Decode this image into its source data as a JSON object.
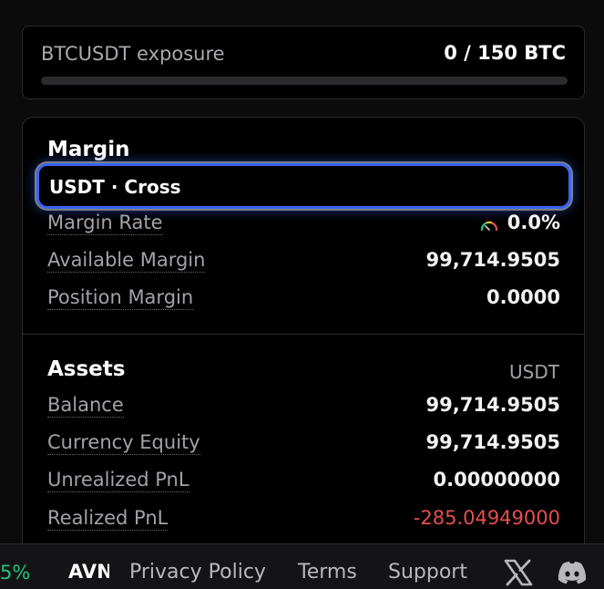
{
  "exposure": {
    "label": "BTCUSDT exposure",
    "value": "0 / 150 BTC",
    "fill_fraction": 0
  },
  "margin": {
    "title": "Margin",
    "selector": "USDT · Cross",
    "rows": [
      {
        "label": "Margin Rate",
        "value": "0.0%"
      },
      {
        "label": "Available Margin",
        "value": "99,714.9505"
      },
      {
        "label": "Position Margin",
        "value": "0.0000"
      }
    ]
  },
  "assets": {
    "title": "Assets",
    "currency": "USDT",
    "rows": [
      {
        "label": "Balance",
        "value": "99,714.9505"
      },
      {
        "label": "Currency Equity",
        "value": "99,714.9505"
      },
      {
        "label": "Unrealized PnL",
        "value": "0.00000000"
      },
      {
        "label": "Realized PnL",
        "value": "-285.04949000"
      }
    ]
  },
  "footer": {
    "pct": "5%",
    "ticker": "AVN",
    "links": [
      "Privacy Policy",
      "Terms",
      "Support"
    ],
    "icons": [
      "x-icon",
      "discord-icon"
    ]
  },
  "colors": {
    "accent": "#3a64f0",
    "positive": "#26c281",
    "negative": "#e54f4f"
  }
}
